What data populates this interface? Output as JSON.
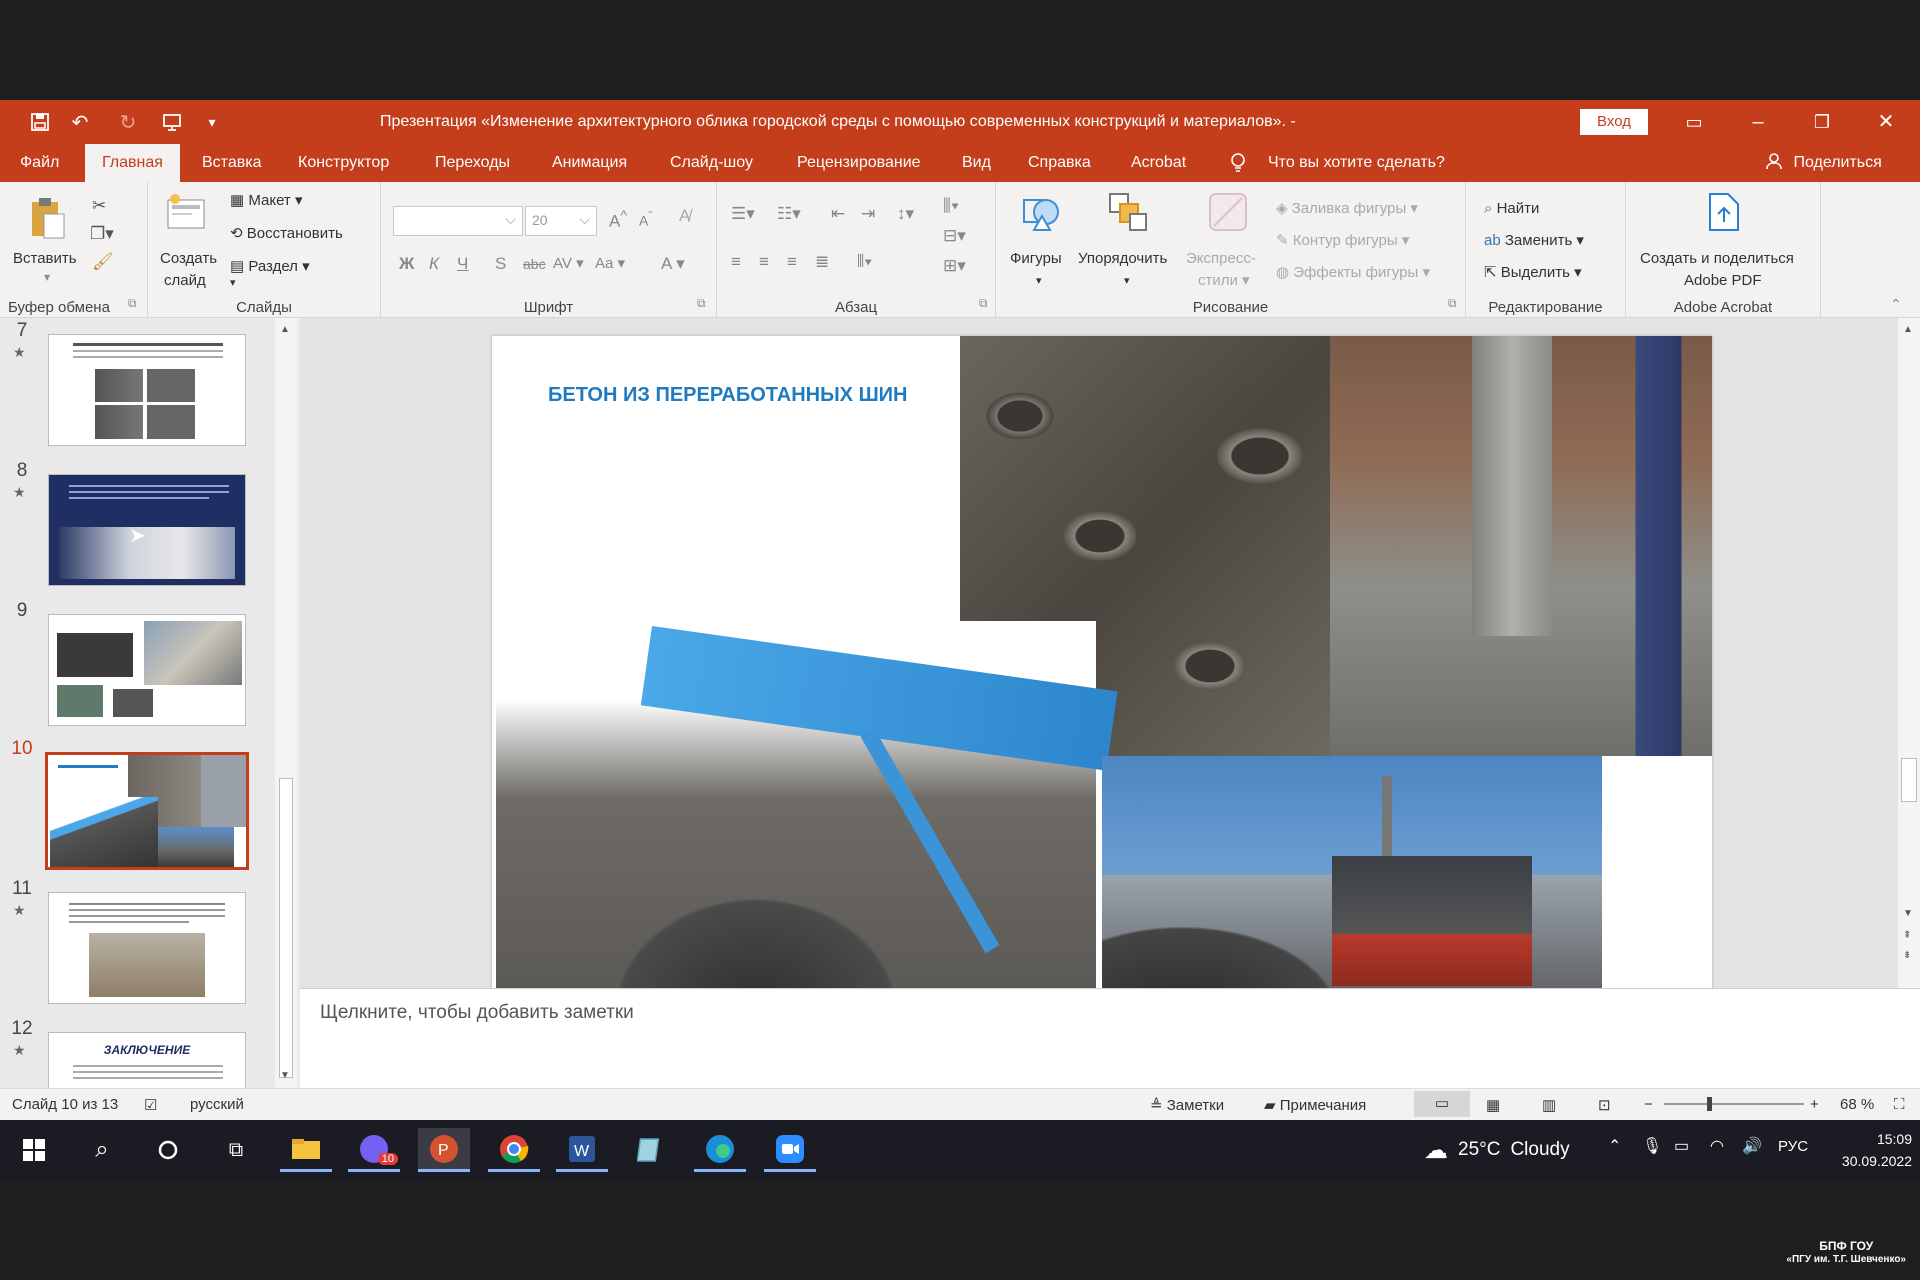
{
  "titlebar": {
    "title": "Презентация «Изменение архитектурного облика городской среды с помощью современных конструкций и материалов». - PowerPoint",
    "signin": "Вход"
  },
  "menu": {
    "tabs": [
      "Файл",
      "Главная",
      "Вставка",
      "Конструктор",
      "Переходы",
      "Анимация",
      "Слайд-шоу",
      "Рецензирование",
      "Вид",
      "Справка",
      "Acrobat"
    ],
    "active": "Главная",
    "tellme": "Что вы хотите сделать?",
    "share": "Поделиться"
  },
  "ribbon": {
    "clipboard": {
      "paste": "Вставить",
      "label": "Буфер обмена"
    },
    "slides": {
      "new_slide_1": "Создать",
      "new_slide_2": "слайд",
      "layout": "Макет",
      "reset": "Восстановить",
      "section": "Раздел",
      "label": "Слайды"
    },
    "font": {
      "size": "20",
      "label": "Шрифт",
      "bold": "Ж",
      "italic": "К",
      "underline": "Ч",
      "shadow": "S",
      "strike": "abc",
      "spacing": "AV",
      "case": "Aa",
      "color": "A"
    },
    "paragraph": {
      "label": "Абзац"
    },
    "drawing": {
      "shapes": "Фигуры",
      "arrange": "Упорядочить",
      "quick_styles_1": "Экспресс-",
      "quick_styles_2": "стили",
      "fill": "Заливка фигуры",
      "outline": "Контур фигуры",
      "effects": "Эффекты фигуры",
      "label": "Рисование"
    },
    "editing": {
      "find": "Найти",
      "replace": "Заменить",
      "select": "Выделить",
      "label": "Редактирование"
    },
    "acrobat": {
      "create_1": "Создать и поделиться",
      "create_2": "Adobe PDF",
      "label": "Adobe Acrobat"
    }
  },
  "thumbnails": [
    {
      "num": "7",
      "star": "★"
    },
    {
      "num": "8",
      "star": "★"
    },
    {
      "num": "9",
      "star": ""
    },
    {
      "num": "10",
      "star": ""
    },
    {
      "num": "11",
      "star": "★"
    },
    {
      "num": "12",
      "star": "★",
      "text": "ЗАКЛЮЧЕНИЕ"
    }
  ],
  "selected_slide": "10",
  "slide": {
    "title": "БЕТОН ИЗ ПЕРЕРАБОТАННЫХ ШИН"
  },
  "notes_placeholder": "Щелкните, чтобы добавить заметки",
  "statusbar": {
    "slide_info": "Слайд 10 из 13",
    "language": "русский",
    "notes": "Заметки",
    "comments": "Примечания",
    "zoom": "68 %",
    "zoom_level": 0.68
  },
  "taskbar": {
    "weather_temp": "25°C",
    "weather_text": "Cloudy",
    "input_lang": "РУС",
    "time": "15:09",
    "date": "30.09.2022",
    "viber_badge": "10"
  },
  "watermark": {
    "line1": "БПФ ГОУ",
    "line2": "«ПГУ им. Т.Г. Шевченко»"
  },
  "colors": {
    "accent": "#c43e1c",
    "slide_title": "#1f7bc0"
  }
}
